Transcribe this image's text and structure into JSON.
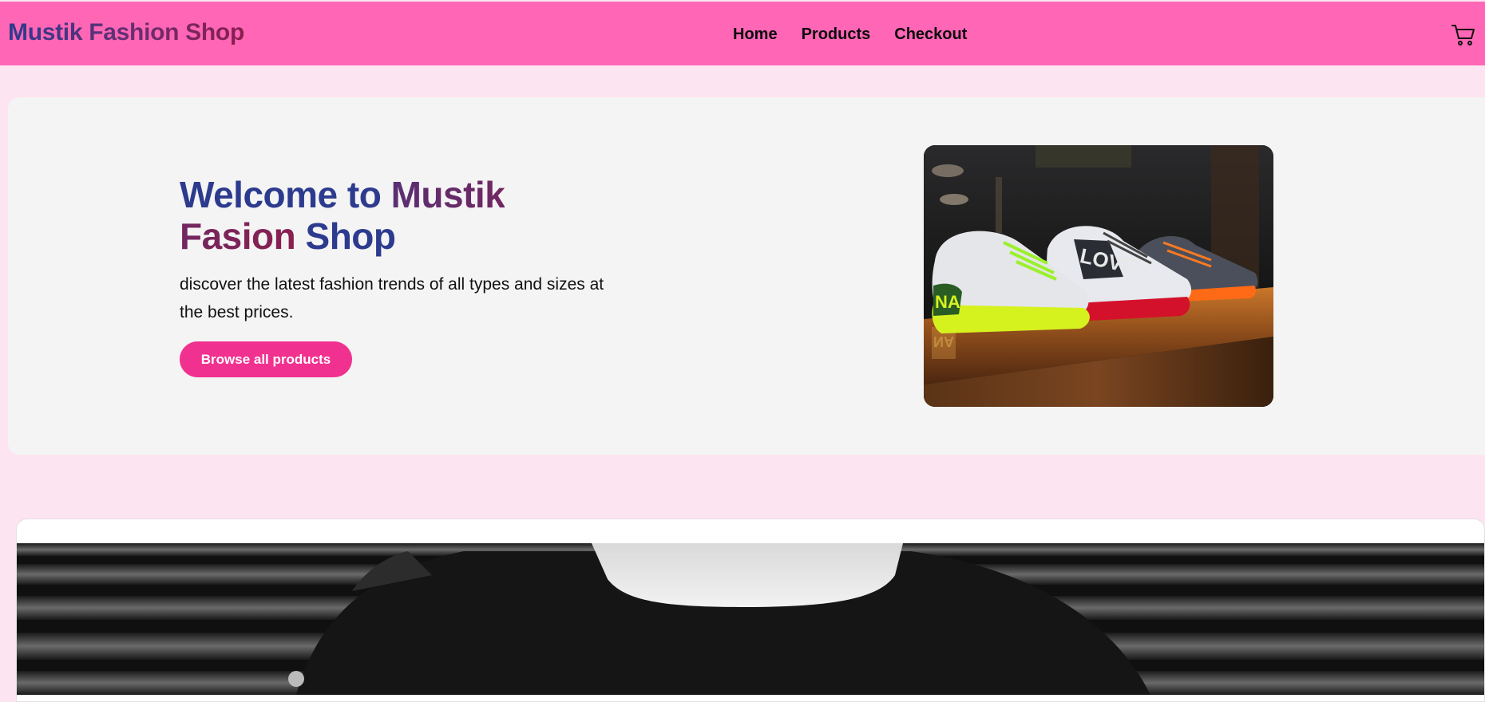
{
  "header": {
    "brand": "Mustik Fashion Shop",
    "nav": [
      "Home",
      "Products",
      "Checkout"
    ],
    "cart_icon": "cart-icon"
  },
  "hero": {
    "title_part1": "Welcome to",
    "title_part2": "Mustik Fasion",
    "title_part3": "Shop",
    "description": "discover the latest fashion trends of all types and sizes at the best prices.",
    "button_label": "Browse all products"
  },
  "colors": {
    "topbar": "#ff66b6",
    "page_bg": "#fde4f1",
    "hero_bg": "#f4f4f4",
    "button": "#f1318f",
    "title_blue": "#2d3b8e",
    "title_maroon": "#8a1f4f"
  }
}
